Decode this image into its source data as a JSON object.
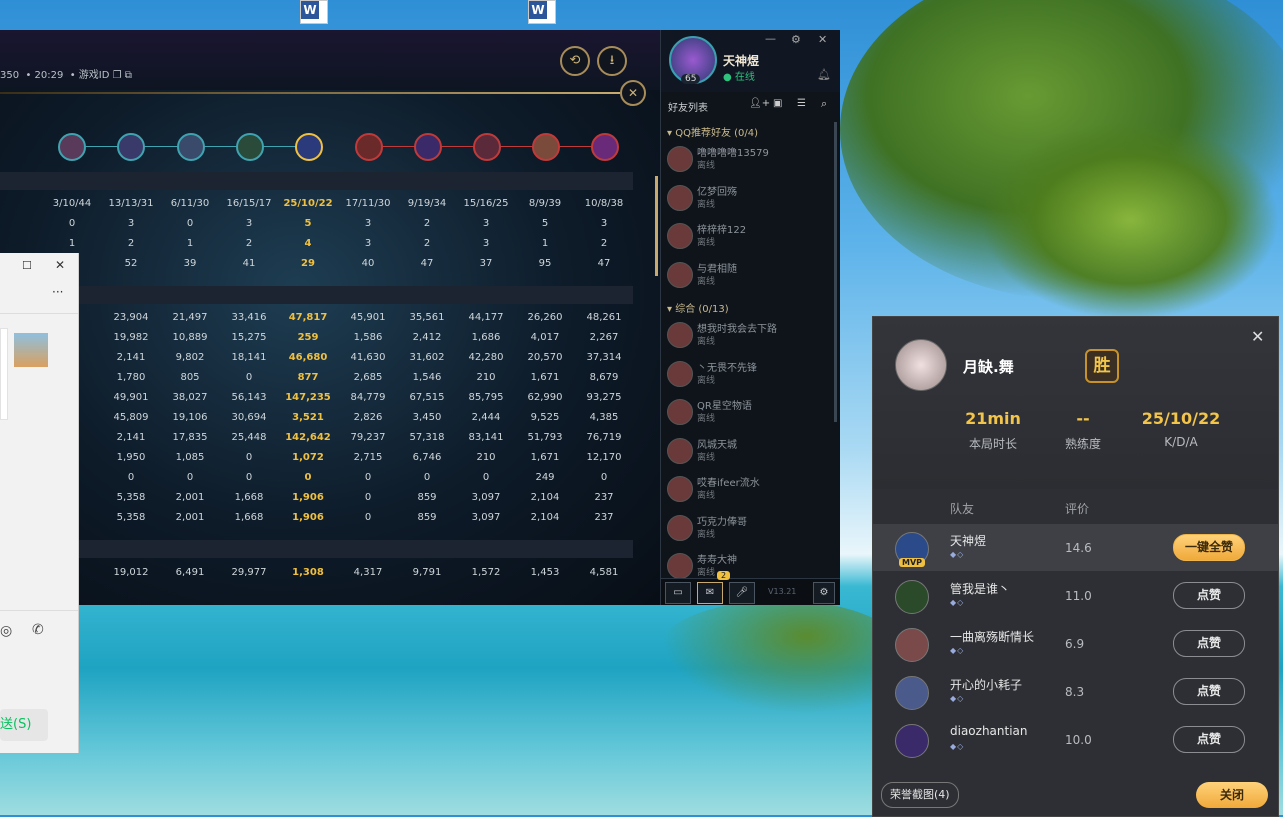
{
  "desktop": {
    "word_icon_letter": "W"
  },
  "game": {
    "header_meta": {
      "prefix": "350",
      "time": "20:29",
      "game_id_label": "游戏ID"
    },
    "stat_rows": [
      [
        "3/10/44",
        "13/13/31",
        "6/11/30",
        "16/15/17",
        "25/10/22",
        "17/11/30",
        "9/19/34",
        "15/16/25",
        "8/9/39",
        "10/8/38"
      ],
      [
        "0",
        "3",
        "0",
        "3",
        "5",
        "3",
        "2",
        "3",
        "5",
        "3"
      ],
      [
        "1",
        "2",
        "1",
        "2",
        "4",
        "3",
        "2",
        "3",
        "1",
        "2"
      ],
      [
        "",
        "52",
        "39",
        "41",
        "29",
        "40",
        "47",
        "37",
        "95",
        "47"
      ],
      [
        "04",
        "23,904",
        "21,497",
        "33,416",
        "47,817",
        "45,901",
        "35,561",
        "44,177",
        "26,260",
        "48,261"
      ],
      [
        "7",
        "19,982",
        "10,889",
        "15,275",
        "259",
        "1,586",
        "2,412",
        "1,686",
        "4,017",
        "2,267"
      ],
      [
        "4",
        "2,141",
        "9,802",
        "18,141",
        "46,680",
        "41,630",
        "31,602",
        "42,280",
        "20,570",
        "37,314"
      ],
      [
        "2",
        "1,780",
        "805",
        "0",
        "877",
        "2,685",
        "1,546",
        "210",
        "1,671",
        "8,679"
      ],
      [
        "04",
        "49,901",
        "38,027",
        "56,143",
        "147,235",
        "84,779",
        "67,515",
        "85,795",
        "62,990",
        "93,275"
      ],
      [
        "5",
        "45,809",
        "19,106",
        "30,694",
        "3,521",
        "2,826",
        "3,450",
        "2,444",
        "9,525",
        "4,385"
      ],
      [
        "42",
        "2,141",
        "17,835",
        "25,448",
        "142,642",
        "79,237",
        "57,318",
        "83,141",
        "51,793",
        "76,719"
      ],
      [
        "7",
        "1,950",
        "1,085",
        "0",
        "1,072",
        "2,715",
        "6,746",
        "210",
        "1,671",
        "12,170"
      ],
      [
        "",
        "0",
        "0",
        "0",
        "0",
        "0",
        "0",
        "0",
        "249",
        "0"
      ],
      [
        "5",
        "5,358",
        "2,001",
        "1,668",
        "1,906",
        "0",
        "859",
        "3,097",
        "2,104",
        "237"
      ],
      [
        "5",
        "5,358",
        "2,001",
        "1,668",
        "1,906",
        "0",
        "859",
        "3,097",
        "2,104",
        "237"
      ],
      [
        "37",
        "19,012",
        "6,491",
        "29,977",
        "1,308",
        "4,317",
        "9,791",
        "1,572",
        "1,453",
        "4,581"
      ]
    ],
    "highlight_col": 4
  },
  "friends_panel": {
    "username": "天神煜",
    "status": "在线",
    "level": "65",
    "list_title": "好友列表",
    "group1": "QQ推荐好友 (0/4)",
    "group2": "综合 (0/13)",
    "offline": "离线",
    "friends_g1": [
      "噜噜噜噜13579",
      "亿梦回殇",
      "梓梓梓122",
      "与君相随"
    ],
    "friends_g2": [
      "想我时我会去下路",
      "丶无畏不先锋",
      "QR星空物语",
      "风城天城",
      "哎春ifeer流水",
      "巧克力俸哥",
      "寿寿大神"
    ],
    "badge_count": "2",
    "version": "V13.21"
  },
  "chat_window": {
    "send_label": "送(S)",
    "more": "···"
  },
  "result": {
    "player_name": "月缺.舞",
    "result_badge": "胜",
    "stats": [
      {
        "value": "21min",
        "label": "本局时长"
      },
      {
        "value": "--",
        "label": "熟练度"
      },
      {
        "value": "25/10/22",
        "label": "K/D/A"
      }
    ],
    "col_teammate": "队友",
    "col_rating": "评价",
    "teammates": [
      {
        "name": "天神煜",
        "score": "14.6",
        "button": "一键全赞"
      },
      {
        "name": "管我是谁丶",
        "score": "11.0",
        "button": "点赞"
      },
      {
        "name": "一曲离殇断情长",
        "score": "6.9",
        "button": "点赞"
      },
      {
        "name": "开心的小耗子",
        "score": "8.3",
        "button": "点赞"
      },
      {
        "name": "diaozhantian",
        "score": "10.0",
        "button": "点赞"
      }
    ],
    "mvp_label": "MVP",
    "honor_button": "荣誉截图(4)",
    "close_button": "关闭"
  }
}
